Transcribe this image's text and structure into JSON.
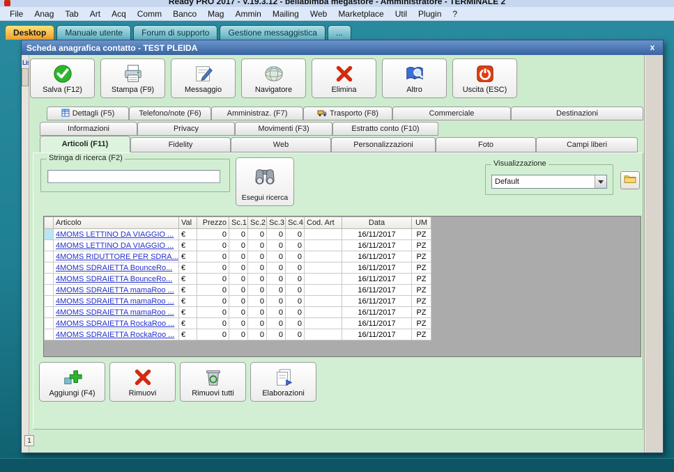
{
  "colors": {
    "teal_background": "#1f8093",
    "dialog_green": "#cdeccd",
    "titlebar_blue": "#38639f",
    "active_tab_orange": "#efa02a",
    "link_blue": "#2230c8"
  },
  "app": {
    "title": "Ready PRO 2017 - V.19.3.12 - bellabimba megastore - Amministratore - TERMINALE 2",
    "menu": [
      "File",
      "Anag",
      "Tab",
      "Art",
      "Acq",
      "Comm",
      "Banco",
      "Mag",
      "Ammin",
      "Mailing",
      "Web",
      "Marketplace",
      "Util",
      "Plugin",
      "?"
    ],
    "desktop_tabs": [
      "Desktop",
      "Manuale utente",
      "Forum di supporto",
      "Gestione messaggistica",
      "..."
    ]
  },
  "background": {
    "left_pane_label": "Lis",
    "page_number": "1"
  },
  "dialog": {
    "title": "Scheda anagrafica contatto - TEST PLEIDA",
    "close_label": "x",
    "toolbar": [
      {
        "label": "Salva (F12)",
        "icon": "save-check-icon"
      },
      {
        "label": "Stampa (F9)",
        "icon": "printer-icon"
      },
      {
        "label": "Messaggio",
        "icon": "message-note-icon"
      },
      {
        "label": "Navigatore",
        "icon": "globe-icon"
      },
      {
        "label": "Elimina",
        "icon": "delete-x-icon"
      },
      {
        "label": "Altro",
        "icon": "book-search-icon"
      },
      {
        "label": "Uscita (ESC)",
        "icon": "power-icon"
      }
    ],
    "tab_row1": [
      "Dettagli (F5)",
      "Telefono/note (F6)",
      "Amministraz. (F7)",
      "Trasporto (F8)",
      "Commerciale",
      "Destinazioni"
    ],
    "tab_row2": [
      "Informazioni",
      "Privacy",
      "Movimenti (F3)",
      "Estratto conto (F10)"
    ],
    "tab_row3": [
      "Articoli (F11)",
      "Fidelity",
      "Web",
      "Personalizzazioni",
      "Foto",
      "Campi liberi"
    ],
    "active_tab": "Articoli (F11)",
    "search": {
      "label": "Stringa di ricerca (F2)",
      "value": ""
    },
    "search_button": "Esegui ricerca",
    "view": {
      "label": "Visualizzazione",
      "selected": "Default"
    },
    "grid": {
      "columns": [
        "",
        "Articolo",
        "Val",
        "Prezzo",
        "Sc.1",
        "Sc.2",
        "Sc.3",
        "Sc.4",
        "Cod. Art",
        "Data",
        "UM"
      ],
      "rows": [
        [
          "4MOMS LETTINO DA VIAGGIO ...",
          "€",
          "0",
          "0",
          "0",
          "0",
          "0",
          "",
          "16/11/2017",
          "PZ"
        ],
        [
          "4MOMS LETTINO DA VIAGGIO ...",
          "€",
          "0",
          "0",
          "0",
          "0",
          "0",
          "",
          "16/11/2017",
          "PZ"
        ],
        [
          "4MOMS RIDUTTORE PER SDRA...",
          "€",
          "0",
          "0",
          "0",
          "0",
          "0",
          "",
          "16/11/2017",
          "PZ"
        ],
        [
          "4MOMS SDRAIETTA BounceRo...",
          "€",
          "0",
          "0",
          "0",
          "0",
          "0",
          "",
          "16/11/2017",
          "PZ"
        ],
        [
          "4MOMS SDRAIETTA BounceRo...",
          "€",
          "0",
          "0",
          "0",
          "0",
          "0",
          "",
          "16/11/2017",
          "PZ"
        ],
        [
          "4MOMS SDRAIETTA mamaRoo ...",
          "€",
          "0",
          "0",
          "0",
          "0",
          "0",
          "",
          "16/11/2017",
          "PZ"
        ],
        [
          "4MOMS SDRAIETTA mamaRoo ...",
          "€",
          "0",
          "0",
          "0",
          "0",
          "0",
          "",
          "16/11/2017",
          "PZ"
        ],
        [
          "4MOMS SDRAIETTA mamaRoo ...",
          "€",
          "0",
          "0",
          "0",
          "0",
          "0",
          "",
          "16/11/2017",
          "PZ"
        ],
        [
          "4MOMS SDRAIETTA RockaRoo ...",
          "€",
          "0",
          "0",
          "0",
          "0",
          "0",
          "",
          "16/11/2017",
          "PZ"
        ],
        [
          "4MOMS SDRAIETTA RockaRoo ...",
          "€",
          "0",
          "0",
          "0",
          "0",
          "0",
          "",
          "16/11/2017",
          "PZ"
        ]
      ]
    },
    "bottom_buttons": [
      "Aggiungi (F4)",
      "Rimuovi",
      "Rimuovi tutti",
      "Elaborazioni"
    ]
  }
}
